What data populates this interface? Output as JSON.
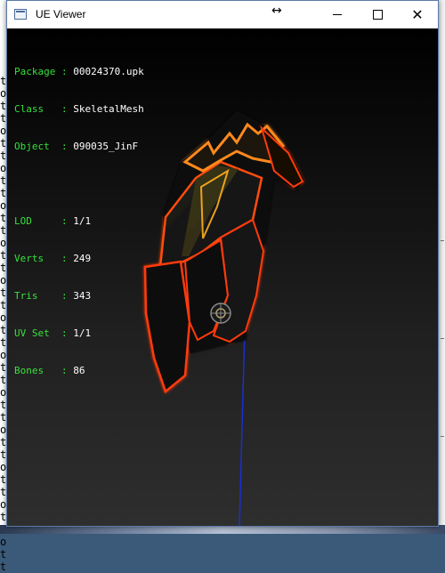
{
  "window": {
    "title": "UE Viewer"
  },
  "info": {
    "object_rows": [
      {
        "label": "Package",
        "sep": " : ",
        "value": "00024370.upk"
      },
      {
        "label": "Class  ",
        "sep": " : ",
        "value": "SkeletalMesh"
      },
      {
        "label": "Object ",
        "sep": " : ",
        "value": "090035_JinF"
      }
    ],
    "stat_rows": [
      {
        "label": "LOD    ",
        "sep": " : ",
        "value": "1/1"
      },
      {
        "label": "Verts  ",
        "sep": " : ",
        "value": "249"
      },
      {
        "label": "Tris   ",
        "sep": " : ",
        "value": "343"
      },
      {
        "label": "UV Set ",
        "sep": " : ",
        "value": "1/1"
      },
      {
        "label": "Bones  ",
        "sep": " : ",
        "value": "86"
      }
    ]
  },
  "colors": {
    "label": "#38e03c",
    "value": "#ffffff",
    "bone_line": "#1a2fd0",
    "glow": "#ff5a10"
  }
}
